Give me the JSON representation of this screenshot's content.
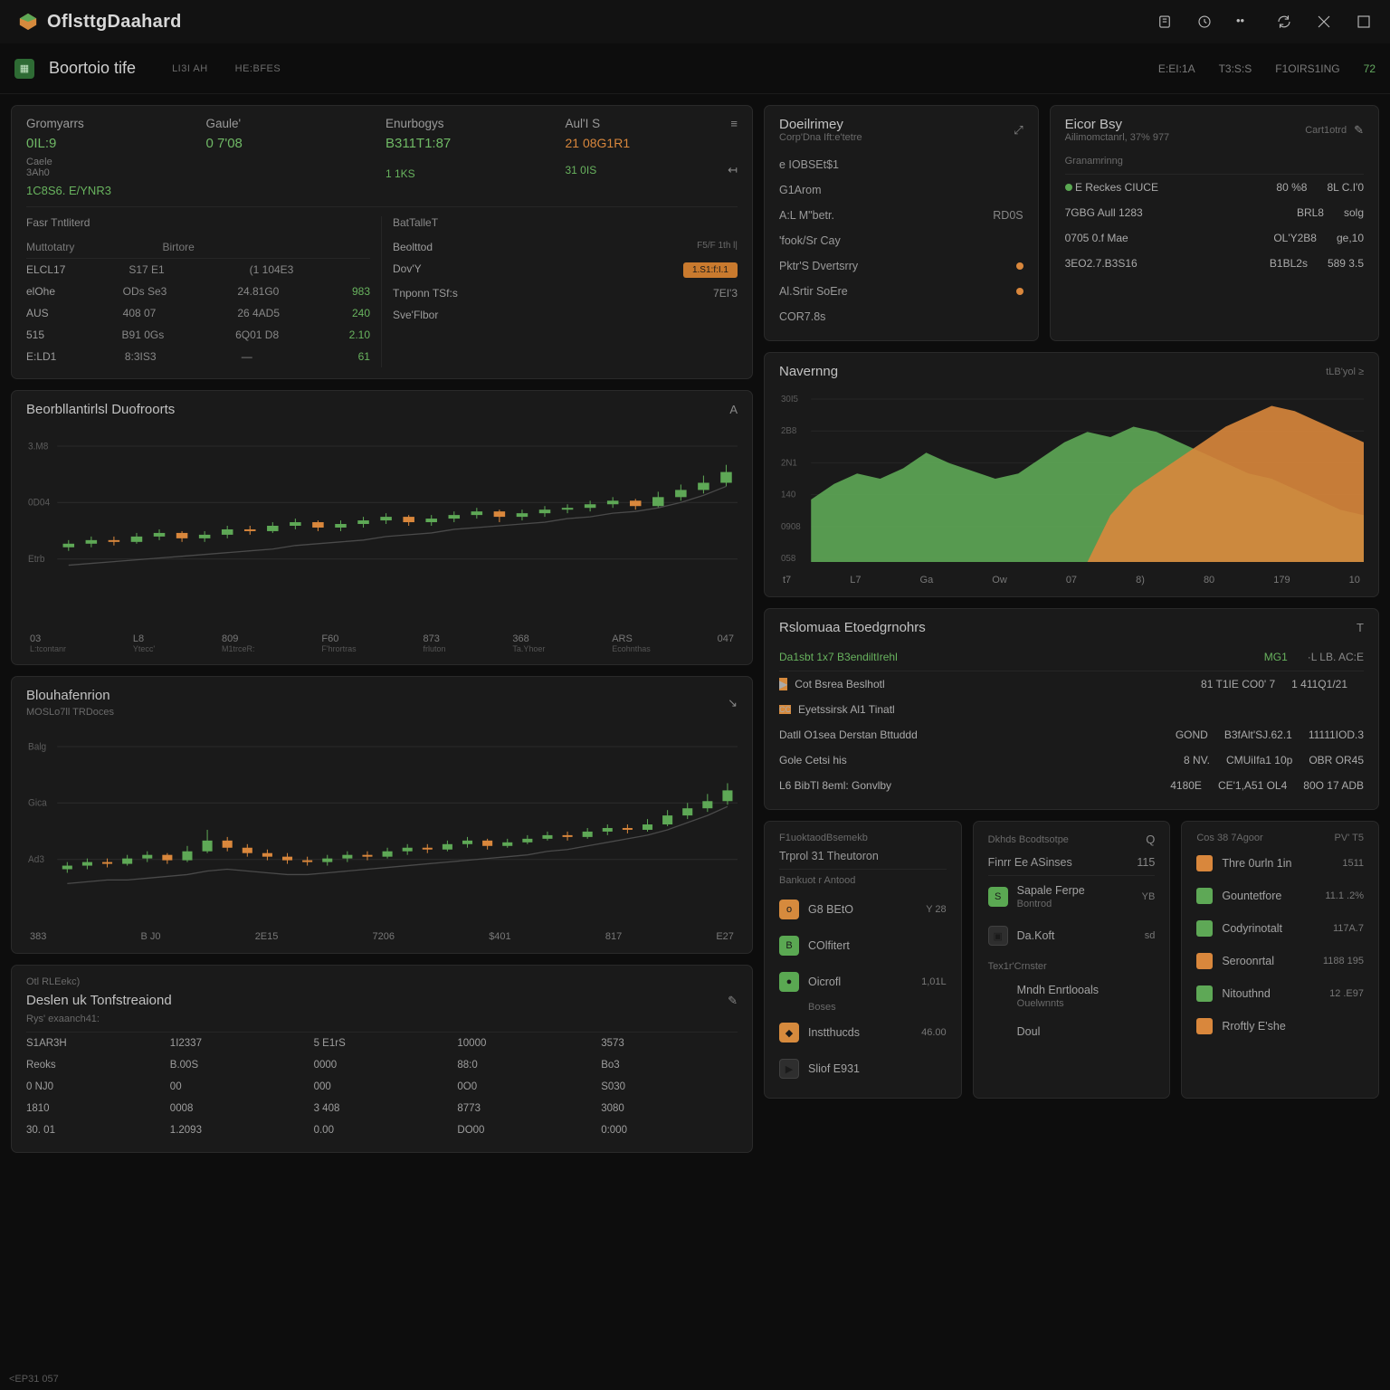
{
  "topbar": {
    "title": "OflsttgDaahard",
    "icons": [
      "notif-icon",
      "clock-icon",
      "more-icon",
      "refresh-icon",
      "settings-icon",
      "fullscreen-icon"
    ]
  },
  "header": {
    "title": "Boortoio tife",
    "tabs": [
      "LI3I AH",
      "HE:BFES"
    ],
    "right": [
      "E:EI:1A",
      "T3:S:S",
      "F1OIRS1ING",
      "72"
    ]
  },
  "summaryCard": {
    "cols": [
      {
        "label": "Gromyarrs",
        "value": "0IL:9",
        "sub": "Caele",
        "sub2": "3Ah0",
        "sub3": "1C8S6. E/YNR3"
      },
      {
        "label": "Gaule'",
        "value": "0 7'08"
      },
      {
        "label": "Enurbogys",
        "value": "B311T1:87",
        "sub": "1 1KS"
      },
      {
        "label": "Aul'I S",
        "value": "21 08G1R1",
        "sub": "31 0IS"
      }
    ],
    "leftList": {
      "head": "Fasr Tntliterd",
      "rowsHead": [
        "Muttotatry",
        "Birtore"
      ],
      "rows": [
        {
          "a": "ELCL17",
          "b": "S17 E1",
          "c": "(1 104E3"
        },
        {
          "a": "elOhe",
          "b": "ODs Se3",
          "c": "24.81G0",
          "d": "983"
        },
        {
          "a": "AUS",
          "b": "408 07",
          "c": "26 4AD5",
          "d": "240"
        },
        {
          "a": "515",
          "b": "B91 0Gs",
          "c": "6Q01 D8",
          "d": "2.10"
        },
        {
          "a": "E:LD1",
          "b": "8:3IS3",
          "c": "—",
          "d": "61"
        }
      ]
    },
    "rightList": {
      "head": "BatTalleT",
      "rows": [
        {
          "a": "Beolttod",
          "b": "F5/F 1th l|",
          "btn": true
        },
        {
          "a": "Dov'Y",
          "b": "",
          "btnLabel": "1.S1:f:I.1"
        },
        {
          "a": "Tnponn TSf:s",
          "b": "7EI'3"
        },
        {
          "a": "Sve'Flbor",
          "b": ""
        }
      ]
    }
  },
  "chart1": {
    "title": "Beorbllantirlsl Duofroorts",
    "action": "A",
    "xlabels": [
      {
        "t": "03",
        "s": "L:tcontanr"
      },
      {
        "t": "L8",
        "s": "Ytecc'"
      },
      {
        "t": "809",
        "s": "M1trceR:"
      },
      {
        "t": "F60",
        "s": "F'hrortras"
      },
      {
        "t": "873",
        "s": "frluton"
      },
      {
        "t": "368",
        "s": "Ta.Yhoer"
      },
      {
        "t": "ARS",
        "s": "Ecohnthas"
      },
      {
        "t": "047",
        "s": ""
      }
    ],
    "ylabels": [
      "3.M8",
      "0D04",
      "Etrb"
    ]
  },
  "chart2": {
    "title": "Blouhafenrion",
    "sub": "MOSLo7ll TRDoces",
    "xlabels": [
      "383",
      "B J0",
      "2E15",
      "7206",
      "$401",
      "817",
      "E27"
    ],
    "ylabels": [
      "Balg",
      "Gica",
      "Ad3"
    ]
  },
  "dailyPanel": {
    "title": "Doeilrimey",
    "sub": "Corp'Dna Ift:e'tetre",
    "rows": [
      {
        "a": "e IOBSEt$1",
        "b": ""
      },
      {
        "a": "G1Arom",
        "b": ""
      },
      {
        "a": "A:L M\"betr.",
        "b": "RD0S",
        "dot": false
      },
      {
        "a": "'fook/Sr Cay",
        "b": "",
        "dot": false
      },
      {
        "a": "Pktr'S Dvertsrry",
        "b": "",
        "dot": "red"
      },
      {
        "a": "Al.Srtir SoEre",
        "b": "",
        "dot": "red"
      },
      {
        "a": "COR7.8s",
        "b": ""
      }
    ]
  },
  "bookPanel": {
    "title": "Eicor Bsy",
    "sub": "Ailimomctanrl, 37% 977",
    "action": "Cart1otrd",
    "head": "Granamrinng",
    "rows": [
      {
        "a": "E Reckes CIUCE",
        "b": "80 %8",
        "c": "8L C.I'0",
        "dot": "green"
      },
      {
        "a": "7GBG Aull 1283",
        "b": "BRL8",
        "c": "solg",
        "dot": false
      },
      {
        "a": "0705 0.f Mae",
        "b": "OL'Y2B8",
        "c": "ge,10",
        "dot": false
      },
      {
        "a": "3EO2.7.B3S16",
        "b": "B1BL2s",
        "c": "589 3.5",
        "dot": false
      }
    ]
  },
  "navChart": {
    "title": "Navernng",
    "action": "tLB'yol ≥",
    "ylabels": [
      "30I5",
      "2B8",
      "2N1",
      "140",
      "0908",
      "058"
    ],
    "xlabels": [
      "t7",
      "L7",
      "Ga",
      "Ow",
      "07",
      "8)",
      "80",
      "179",
      "10"
    ]
  },
  "eventsPanel": {
    "title": "Rslomuaa Etoedgrnohrs",
    "action": "T",
    "head": {
      "a": "Da1sbt 1x7 B3endiltIrehl",
      "b": "MG1",
      "c": "·L LB. AC:E"
    },
    "rows": [
      {
        "icon": "o",
        "a": "Cot Bsrea Beslhotl",
        "b": "81 T1IE CO0' 7",
        "c": "1 411Q1/21"
      },
      {
        "icon": "badge",
        "a": "Eyetssirsk Al1 Tinatl",
        "b": "",
        "c": ""
      },
      {
        "a": "Datll O1sea Derstan Bttuddd",
        "b": "GOND",
        "c": "B3fAlt'SJ.62.1",
        "d": "11111IOD.3"
      },
      {
        "a": "Gole Cetsi his",
        "b": "8 NV.",
        "c": "CMUiIfa1 10p",
        "d": "OBR OR45"
      },
      {
        "a": "L6 BibTl 8eml: Gonvlby",
        "b": "4180E",
        "c": "CE'1,A51 OL4",
        "d": "80O 17 ADB"
      }
    ]
  },
  "bottomTable": {
    "preTitle": "Otl RLEekc)",
    "title": "Deslen uk Tonfstreaiond",
    "sub": "Rys' exaanch41:",
    "head": [
      "",
      "",
      "",
      ""
    ],
    "rows": [
      [
        "S1AR3H",
        "1I2337",
        "5 E1rS",
        "10000",
        "3573"
      ],
      [
        "Reoks",
        "B.00S",
        "0000",
        "88:0",
        "Bo3"
      ],
      [
        "0 NJ0",
        "00",
        "000",
        "0O0",
        "S030"
      ],
      [
        "1810",
        "0008",
        "3 408",
        "8773",
        "3080"
      ],
      [
        "30. 01",
        "1.2093",
        "0.00",
        "DO00",
        "0:000"
      ]
    ]
  },
  "list1": {
    "title": "F1uoktaodBsemekb",
    "head": {
      "a": "Trprol 31 Theutoron",
      "b": ""
    },
    "head2": {
      "a": "Bankuot r Antood",
      "b": ""
    },
    "items": [
      {
        "icon": "o",
        "color": "bi-orange",
        "label": "G8 BEtO",
        "v": "Y 28"
      },
      {
        "icon": "B",
        "color": "bi-green",
        "label": "COlfitert",
        "v": ""
      },
      {
        "icon": "●",
        "color": "bi-green",
        "label": "Oicrofl",
        "v": "1,01L"
      },
      {
        "sub": "Boses"
      },
      {
        "icon": "◆",
        "color": "bi-orange",
        "label": "Instthucds",
        "v": "46.00"
      },
      {
        "icon": "▶",
        "color": "bi-dark",
        "label": "Sliof E931",
        "v": ""
      }
    ]
  },
  "list2": {
    "title": "Dkhds Bcodtsotpe",
    "action": "Q",
    "head": {
      "a": "Finrr Ee ASinses",
      "b": "115"
    },
    "items": [
      {
        "icon": "S",
        "color": "bi-green",
        "label": "Sapale Ferpe",
        "sub": "Bontrod",
        "v": "YB"
      },
      {
        "icon": "▣",
        "color": "bi-dark",
        "label": "Da.Koft",
        "v": "sd"
      },
      {
        "label": "Tex1r'Crnster",
        "head": true
      },
      {
        "icon": "",
        "label": "Mndh Enrtlooals",
        "sub": "Ouelwnnts",
        "v": ""
      },
      {
        "icon": "",
        "label": "Doul",
        "v": ""
      }
    ]
  },
  "list3": {
    "title": "Cos 38 7Agoor",
    "action": "PV' T5",
    "items": [
      {
        "sq": "o",
        "label": "Thre 0urln 1in",
        "v": "1511"
      },
      {
        "sq": "g",
        "label": "Gountetfore",
        "v": "11.1 .2%"
      },
      {
        "sq": "g",
        "label": "Codyrinotalt",
        "v": "117A.7"
      },
      {
        "sq": "o",
        "label": "Seroonrtal",
        "v": "1188 195"
      },
      {
        "sq": "g",
        "label": "Nitouthnd",
        "v": "12 .E97"
      },
      {
        "sq": "o",
        "label": "Rroftly E'she",
        "v": ""
      }
    ]
  },
  "footer": "<EP31 057",
  "chart_data": [
    {
      "id": "chart1-candles",
      "type": "candlestick",
      "title": "Beorbllantirlsl Duofroorts",
      "ylim": [
        0,
        100
      ],
      "x": [
        0,
        1,
        2,
        3,
        4,
        5,
        6,
        7,
        8,
        9,
        10,
        11,
        12,
        13,
        14,
        15,
        16,
        17,
        18,
        19,
        20,
        21,
        22,
        23,
        24,
        25,
        26,
        27,
        28,
        29
      ],
      "open": [
        38,
        40,
        42,
        41,
        44,
        46,
        43,
        45,
        48,
        47,
        50,
        52,
        49,
        51,
        53,
        55,
        52,
        54,
        56,
        58,
        55,
        57,
        59,
        60,
        62,
        64,
        61,
        66,
        70,
        74
      ],
      "close": [
        40,
        42,
        41,
        44,
        46,
        43,
        45,
        48,
        47,
        50,
        52,
        49,
        51,
        53,
        55,
        52,
        54,
        56,
        58,
        55,
        57,
        59,
        60,
        62,
        64,
        61,
        66,
        70,
        74,
        80
      ],
      "high": [
        42,
        44,
        44,
        46,
        48,
        47,
        47,
        50,
        50,
        52,
        54,
        53,
        53,
        55,
        57,
        56,
        56,
        58,
        60,
        59,
        59,
        61,
        62,
        64,
        66,
        65,
        69,
        73,
        78,
        84
      ],
      "low": [
        36,
        38,
        39,
        40,
        42,
        41,
        41,
        43,
        45,
        46,
        48,
        47,
        47,
        49,
        51,
        50,
        50,
        52,
        54,
        52,
        53,
        55,
        57,
        58,
        60,
        59,
        60,
        64,
        68,
        72
      ],
      "line": [
        28,
        29,
        30,
        31,
        32,
        33,
        34,
        35,
        36,
        37,
        39,
        40,
        41,
        42,
        44,
        45,
        46,
        48,
        49,
        50,
        51,
        52,
        54,
        55,
        57,
        58,
        60,
        63,
        67,
        72
      ]
    },
    {
      "id": "chart2-candles",
      "type": "candlestick",
      "title": "Blouhafenrion",
      "ylim": [
        0,
        100
      ],
      "x": [
        0,
        1,
        2,
        3,
        4,
        5,
        6,
        7,
        8,
        9,
        10,
        11,
        12,
        13,
        14,
        15,
        16,
        17,
        18,
        19,
        20,
        21,
        22,
        23,
        24,
        25,
        26,
        27,
        28,
        29,
        30,
        31,
        32,
        33
      ],
      "open": [
        26,
        28,
        30,
        29,
        32,
        34,
        31,
        36,
        42,
        38,
        35,
        33,
        31,
        30,
        32,
        34,
        33,
        36,
        38,
        37,
        40,
        42,
        39,
        41,
        43,
        45,
        44,
        47,
        49,
        48,
        51,
        56,
        60,
        64
      ],
      "close": [
        28,
        30,
        29,
        32,
        34,
        31,
        36,
        42,
        38,
        35,
        33,
        31,
        30,
        32,
        34,
        33,
        36,
        38,
        37,
        40,
        42,
        39,
        41,
        43,
        45,
        44,
        47,
        49,
        48,
        51,
        56,
        60,
        64,
        70
      ],
      "high": [
        30,
        32,
        32,
        34,
        36,
        35,
        39,
        48,
        44,
        40,
        37,
        35,
        33,
        34,
        36,
        36,
        38,
        40,
        40,
        42,
        44,
        43,
        43,
        45,
        47,
        47,
        49,
        51,
        51,
        54,
        59,
        63,
        68,
        74
      ],
      "low": [
        24,
        26,
        27,
        28,
        30,
        29,
        30,
        35,
        36,
        33,
        31,
        29,
        28,
        28,
        30,
        31,
        32,
        34,
        35,
        36,
        38,
        37,
        38,
        40,
        42,
        42,
        43,
        45,
        46,
        47,
        50,
        54,
        58,
        62
      ],
      "line": [
        18,
        19,
        20,
        20,
        21,
        22,
        23,
        25,
        26,
        25,
        24,
        23,
        23,
        24,
        25,
        26,
        27,
        28,
        29,
        30,
        31,
        32,
        33,
        34,
        36,
        37,
        39,
        41,
        43,
        45,
        48,
        52,
        56,
        61
      ]
    },
    {
      "id": "nav-area",
      "type": "area",
      "title": "Navernng",
      "ylim": [
        0,
        320
      ],
      "x": [
        0,
        1,
        2,
        3,
        4,
        5,
        6,
        7,
        8,
        9,
        10,
        11,
        12,
        13,
        14,
        15,
        16,
        17,
        18,
        19,
        20,
        21,
        22,
        23,
        24
      ],
      "series": [
        {
          "name": "green",
          "color": "#5ea856",
          "values": [
            120,
            150,
            170,
            160,
            180,
            210,
            190,
            175,
            160,
            170,
            200,
            230,
            250,
            240,
            260,
            250,
            230,
            210,
            190,
            170,
            160,
            140,
            120,
            100,
            90
          ]
        },
        {
          "name": "orange",
          "color": "#d9873c",
          "values": [
            0,
            0,
            0,
            0,
            0,
            0,
            0,
            0,
            0,
            0,
            0,
            0,
            0,
            90,
            140,
            170,
            200,
            230,
            260,
            280,
            300,
            290,
            270,
            250,
            230
          ]
        }
      ]
    }
  ]
}
